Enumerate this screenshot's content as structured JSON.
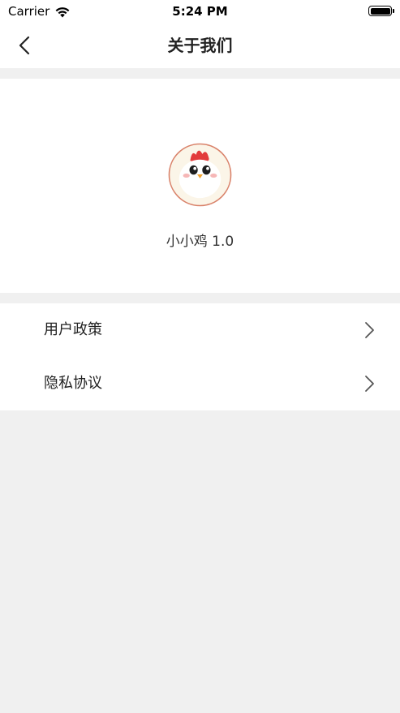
{
  "status_bar": {
    "carrier": "Carrier",
    "time": "5:24 PM"
  },
  "nav": {
    "title": "关于我们"
  },
  "about": {
    "app_version": "小小鸡 1.0"
  },
  "menu": {
    "items": [
      {
        "label": "用户政策",
        "icon": "chevron-right-icon"
      },
      {
        "label": "隐私协议",
        "icon": "chevron-right-icon"
      }
    ]
  },
  "colors": {
    "background": "#f0f0f0",
    "card": "#ffffff",
    "logo_border": "#d9826a",
    "comb_red": "#e23b3b"
  }
}
